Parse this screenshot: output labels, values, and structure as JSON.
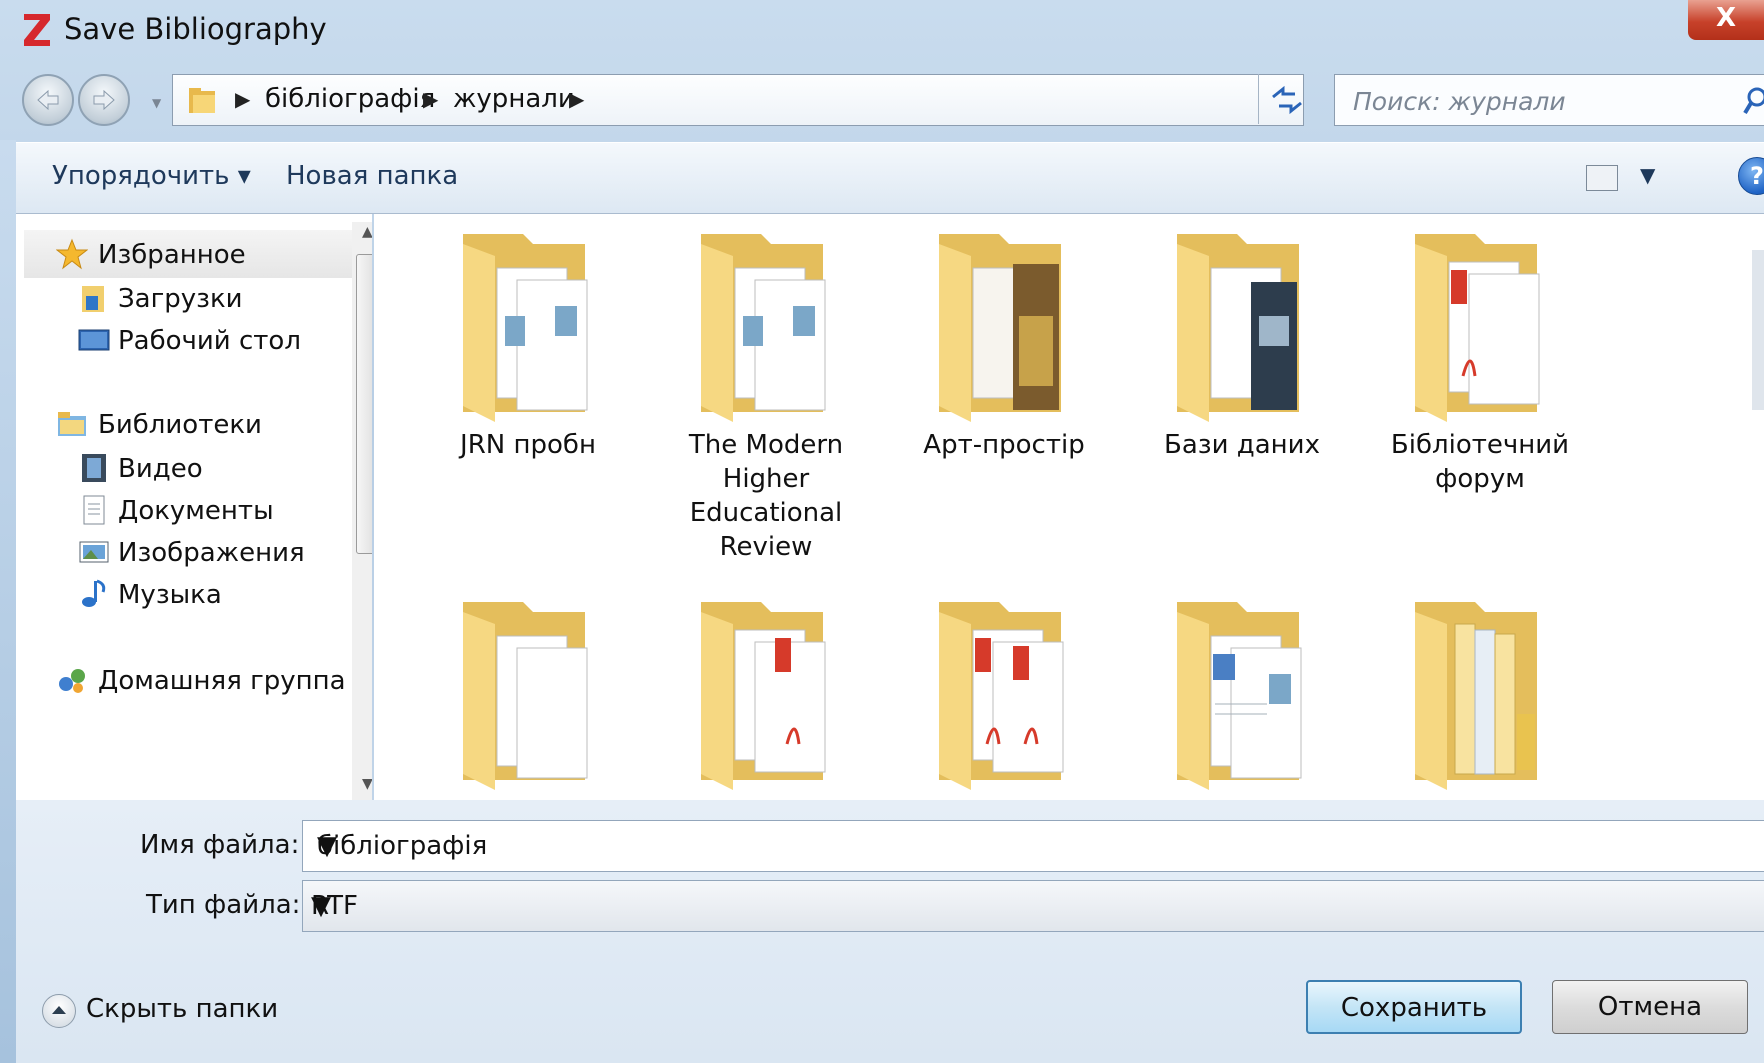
{
  "window": {
    "title": "Save Bibliography",
    "close_label": "X"
  },
  "address": {
    "crumbs": [
      "бібліографія",
      "журнали"
    ],
    "search_placeholder": "Поиск: журнали"
  },
  "toolbar": {
    "organize_label": "Упорядочить ▾",
    "new_folder_label": "Новая папка",
    "help_label": "?"
  },
  "nav": {
    "favorites": "Избранное",
    "downloads": "Загрузки",
    "desktop": "Рабочий стол",
    "libraries": "Библиотеки",
    "video": "Видео",
    "documents": "Документы",
    "images": "Изображения",
    "music": "Музыка",
    "homegroup": "Домашняя группа"
  },
  "folders": [
    {
      "name": "JRN пробн",
      "icon": "folder-docs-icon"
    },
    {
      "name": "The Modern Higher Educational Review",
      "icon": "folder-docs-icon"
    },
    {
      "name": "Арт-простір",
      "icon": "folder-magazine-icon"
    },
    {
      "name": "Бази даних",
      "icon": "folder-photo-icon"
    },
    {
      "name": "Бібліотечний форум",
      "icon": "folder-pdf-icon"
    },
    {
      "name": "",
      "icon": "folder-empty-icon"
    },
    {
      "name": "",
      "icon": "folder-pdf-icon"
    },
    {
      "name": "",
      "icon": "folder-pdf-icon"
    },
    {
      "name": "",
      "icon": "folder-word-icon"
    },
    {
      "name": "",
      "icon": "folder-files-icon"
    }
  ],
  "form": {
    "filename_label": "Имя файла:",
    "filename_value": "бібліографія",
    "filetype_label": "Тип файла:",
    "filetype_value": "RTF"
  },
  "footer": {
    "hide_folders_label": "Скрыть папки",
    "save_label": "Сохранить",
    "cancel_label": "Отмена"
  },
  "colors": {
    "accent": "#1e395b",
    "folder": "#f3d77f",
    "close": "#c7412a"
  }
}
